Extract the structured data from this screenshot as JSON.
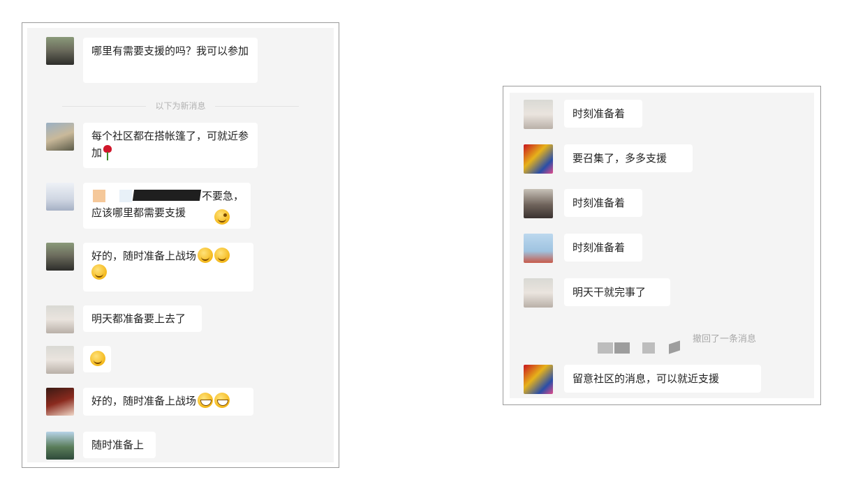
{
  "left_chat": {
    "messages": [
      {
        "text": "哪里有需要支援的吗？我可以参加"
      },
      {
        "text": "每个社区都在搭帐篷了，可就近参加"
      },
      {
        "text": "不要急，应该哪里都需要支援"
      },
      {
        "text": "好的，随时准备上战场"
      },
      {
        "text": "明天都准备要上去了"
      },
      {
        "text": ""
      },
      {
        "text": "好的，随时准备上战场"
      },
      {
        "text": "随时准备上"
      }
    ],
    "new_messages_divider": "以下为新消息"
  },
  "right_chat": {
    "messages": [
      {
        "text": "时刻准备着"
      },
      {
        "text": "要召集了，多多支援"
      },
      {
        "text": "时刻准备着"
      },
      {
        "text": "时刻准备着"
      },
      {
        "text": "明天干就完事了"
      },
      {
        "text": "留意社区的消息，可以就近支援"
      }
    ],
    "recall_notice": "撤回了一条消息"
  },
  "colors": {
    "chat_background": "#f4f4f4",
    "bubble_background": "#ffffff",
    "frame_border": "#9a9a9a",
    "system_text": "#b2b2b2"
  }
}
